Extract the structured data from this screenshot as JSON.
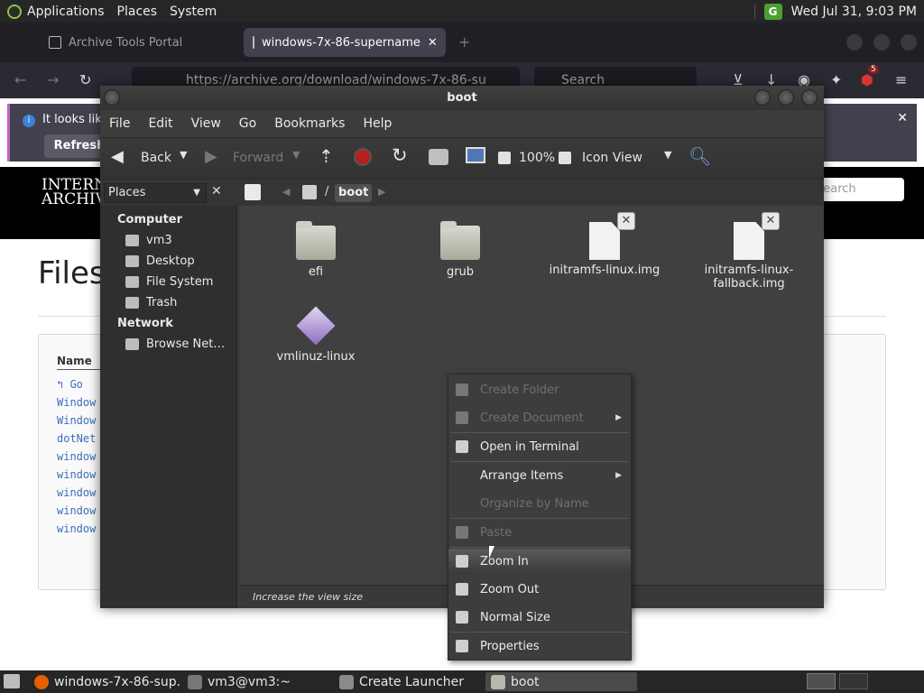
{
  "top_panel": {
    "menus": [
      "Applications",
      "Places",
      "System"
    ],
    "clock": "Wed Jul 31,  9:03 PM"
  },
  "firefox": {
    "tabs": [
      {
        "label": "Archive Tools Portal"
      },
      {
        "label": "windows-7x-86-supername"
      }
    ],
    "url": "https://archive.org/download/windows-7x-86-su",
    "search_placeholder": "Search",
    "badge_count": "5",
    "notice_text": "It looks like",
    "refresh_label": "Refresh",
    "ia_logo_line1": "INTERN",
    "ia_logo_line2": "ARCHIV",
    "ia_search_placeholder": "Search",
    "page_title": "Files",
    "name_header": "Name",
    "go_link": "Go",
    "file_links": [
      "Window",
      "Window",
      "dotNet",
      "window",
      "window",
      "window",
      "window",
      "window"
    ]
  },
  "caja": {
    "title": "boot",
    "menubar": [
      "File",
      "Edit",
      "View",
      "Go",
      "Bookmarks",
      "Help"
    ],
    "toolbar": {
      "back": "Back",
      "forward": "Forward",
      "zoom": "100%",
      "view_mode": "Icon View"
    },
    "sidebar_title": "Places",
    "breadcrumb_current": "boot",
    "sidebar": {
      "computer_header": "Computer",
      "computer_items": [
        "vm3",
        "Desktop",
        "File System",
        "Trash"
      ],
      "network_header": "Network",
      "network_items": [
        "Browse Net…"
      ]
    },
    "files": [
      {
        "name": "efi",
        "type": "folder"
      },
      {
        "name": "grub",
        "type": "folder"
      },
      {
        "name": "initramfs-linux.img",
        "type": "file"
      },
      {
        "name": "initramfs-linux-fallback.img",
        "type": "file"
      },
      {
        "name": "vmlinuz-linux",
        "type": "kernel"
      }
    ],
    "status": "Increase the view size"
  },
  "context_menu": {
    "items": [
      {
        "label": "Create Folder",
        "enabled": false
      },
      {
        "label": "Create Document",
        "enabled": false,
        "submenu": true
      },
      {
        "label": "Open in Terminal",
        "enabled": true
      },
      {
        "label": "Arrange Items",
        "enabled": true,
        "submenu": true
      },
      {
        "label": "Organize by Name",
        "enabled": false
      },
      {
        "label": "Paste",
        "enabled": false
      },
      {
        "label": "Zoom In",
        "enabled": true,
        "highlighted": true
      },
      {
        "label": "Zoom Out",
        "enabled": true
      },
      {
        "label": "Normal Size",
        "enabled": true
      },
      {
        "label": "Properties",
        "enabled": true
      }
    ]
  },
  "taskbar": {
    "tasks": [
      {
        "label": "windows-7x-86-sup..."
      },
      {
        "label": "vm3@vm3:~"
      },
      {
        "label": "Create Launcher"
      },
      {
        "label": "boot"
      }
    ]
  },
  "colors": {
    "panel": "#262626",
    "caja_bg": "#404040",
    "link": "#3c6dbc",
    "highlight": "#5a5a5a"
  }
}
